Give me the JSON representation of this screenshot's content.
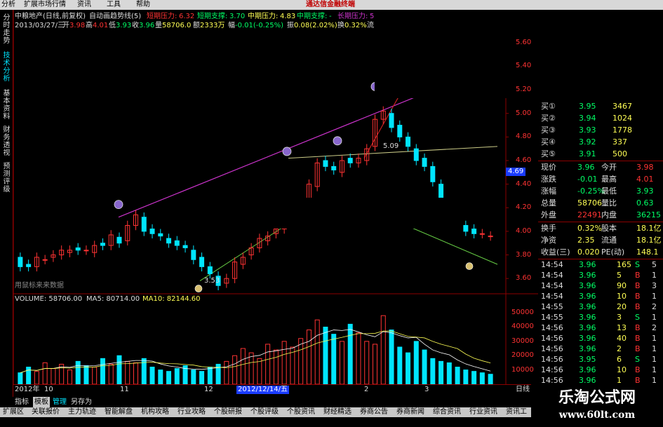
{
  "menu": {
    "items": [
      "分析",
      "扩展市场行情",
      "资讯",
      "工具",
      "帮助"
    ],
    "center_title": "通达信金融终端"
  },
  "sidebar": {
    "tabs": [
      "分时走势",
      "技术分析",
      "基本资料",
      "财务透视",
      "预测评级"
    ],
    "active_index": 1
  },
  "header": {
    "line1": {
      "name": "中粮地产(日线,前复权)",
      "indicator": "自动画趋势线(5)",
      "short_res_label": "短期压力:",
      "short_res_value": "6.32",
      "short_sup_label": "短期支撑:",
      "short_sup_value": "3.70",
      "mid_res_label": "中期压力:",
      "mid_res_value": "4.83",
      "mid_sup_label": "中期支撑:",
      "mid_sup_value": "-",
      "long_res_label": "长期压力:",
      "long_res_value": "5"
    },
    "line2": {
      "date": "2013/03/27/三",
      "open_label": "开",
      "open": "3.98",
      "high_label": "高",
      "high": "4.01",
      "low_label": "低",
      "low": "3.93",
      "close_label": "收",
      "close": "3.96",
      "vol_label": "量",
      "vol": "58706.0",
      "amount_label": "额",
      "amount": "2333万",
      "change_label": "幅",
      "change": "-0.01(-0.25%)",
      "amp_label": "振",
      "amp": "0.08(2.02%)",
      "turnover_label": "换",
      "turnover": "0.32%",
      "flow_label": "流"
    }
  },
  "chart_labels": {
    "peak_price": "5.09",
    "low_price": "3.53",
    "current_price_tag": "4.69",
    "note": "用鼠标来来数据",
    "volume_label": "VOLUME: 58706.00",
    "ma5_label": "MA5: 80714.00",
    "ma10_label": "MA10: 82144.60",
    "x_axis": [
      "2012年",
      "10",
      "11",
      "12",
      "2012/12/14/五",
      "2",
      "3"
    ],
    "price_axis": [
      "5.60",
      "5.40",
      "5.20",
      "5.00",
      "4.80",
      "4.60",
      "4.40",
      "4.20",
      "4.00",
      "3.80",
      "3.60"
    ],
    "volume_axis": [
      "50000",
      "40000",
      "30000",
      "20000",
      "10000"
    ],
    "right_small": "日线",
    "price_axis_values": [
      5.6,
      5.4,
      5.2,
      5.0,
      4.8,
      4.6,
      4.4,
      4.2,
      4.0,
      3.8,
      3.6
    ],
    "volume_axis_values": [
      50000,
      40000,
      30000,
      20000,
      10000
    ]
  },
  "chart_data": {
    "type": "candlestick",
    "title": "",
    "series": [
      {
        "name": "K线",
        "description_open": [
          3.78,
          3.72,
          3.7,
          3.76,
          3.78,
          3.8,
          3.82,
          3.86,
          3.84,
          3.82,
          3.9,
          3.88,
          3.95,
          3.92,
          4.05,
          4.12,
          4.02,
          3.98,
          3.94,
          3.92,
          3.88,
          3.84,
          3.78,
          3.7,
          3.62,
          3.56,
          3.6,
          3.72,
          3.8,
          3.86,
          3.92,
          3.98,
          4.02,
          4.08,
          4.1,
          4.15,
          4.38,
          4.6,
          4.55,
          4.5,
          4.62,
          4.58,
          4.6,
          4.72,
          4.95,
          5.0,
          4.9,
          4.8,
          4.7,
          4.62,
          4.55,
          4.4,
          4.2,
          4.1,
          4.05,
          4.02,
          3.98,
          3.96
        ]
      },
      {
        "name": "VOLUME",
        "values": [
          8000,
          12000,
          9000,
          15000,
          11000,
          14000,
          10000,
          16000,
          13000,
          12000,
          18000,
          14000,
          20000,
          16000,
          15000,
          18000,
          12000,
          10000,
          9000,
          11000,
          13000,
          10000,
          9000,
          12000,
          14000,
          16000,
          20000,
          25000,
          22000,
          18000,
          28000,
          24000,
          30000,
          26000,
          32000,
          38000,
          45000,
          40000,
          35000,
          30000,
          42000,
          36000,
          30000,
          28000,
          48000,
          38000,
          26000,
          22000,
          30000,
          24000,
          18000,
          16000,
          15000,
          12000,
          10000,
          9000,
          8000,
          7000
        ]
      }
    ],
    "ylim": [
      3.5,
      5.7
    ],
    "volume_ylim": [
      0,
      52000
    ]
  },
  "quote": {
    "bids": [
      {
        "label": "买①",
        "price": "3.95",
        "vol": "3467"
      },
      {
        "label": "买②",
        "price": "3.94",
        "vol": "1024"
      },
      {
        "label": "买③",
        "price": "3.93",
        "vol": "1778"
      },
      {
        "label": "买④",
        "price": "3.92",
        "vol": "337"
      },
      {
        "label": "买⑤",
        "price": "3.91",
        "vol": "500"
      }
    ],
    "stats": [
      {
        "l1": "现价",
        "v1": "3.96",
        "l2": "今开",
        "v2": "3.98",
        "c1": "#00ff66",
        "c2": "#ff3333"
      },
      {
        "l1": "涨跌",
        "v1": "-0.01",
        "l2": "最高",
        "v2": "4.01",
        "c1": "#00ff66",
        "c2": "#ff3333"
      },
      {
        "l1": "涨幅",
        "v1": "-0.25%",
        "l2": "最低",
        "v2": "3.93",
        "c1": "#00ff66",
        "c2": "#00ff66"
      },
      {
        "l1": "总量",
        "v1": "58706",
        "l2": "量比",
        "v2": "0.63",
        "c1": "#ffff55",
        "c2": "#00ff66"
      },
      {
        "l1": "外盘",
        "v1": "22491",
        "l2": "内盘",
        "v2": "36215",
        "c1": "#ff3333",
        "c2": "#00ff66"
      },
      {
        "l1": "换手",
        "v1": "0.32%",
        "l2": "股本",
        "v2": "18.1亿",
        "c1": "#ffff55",
        "c2": "#ffff55"
      },
      {
        "l1": "净资",
        "v1": "2.35",
        "l2": "流通",
        "v2": "18.1亿",
        "c1": "#ffff55",
        "c2": "#ffff55"
      },
      {
        "l1": "收益(三)",
        "v1": "0.020",
        "l2": "PE(动)",
        "v2": "148.1",
        "c1": "#ffff55",
        "c2": "#ffff55"
      }
    ],
    "ticks": [
      {
        "time": "14:54",
        "price": "3.96",
        "vol": "165",
        "side": "S",
        "extra": "5"
      },
      {
        "time": "14:54",
        "price": "3.96",
        "vol": "5",
        "side": "B",
        "extra": "1"
      },
      {
        "time": "14:54",
        "price": "3.96",
        "vol": "90",
        "side": "B",
        "extra": "3"
      },
      {
        "time": "14:54",
        "price": "3.96",
        "vol": "10",
        "side": "B",
        "extra": "1"
      },
      {
        "time": "14:55",
        "price": "3.96",
        "vol": "20",
        "side": "B",
        "extra": "2"
      },
      {
        "time": "14:55",
        "price": "3.96",
        "vol": "3",
        "side": "S",
        "extra": "1"
      },
      {
        "time": "14:56",
        "price": "3.96",
        "vol": "13",
        "side": "B",
        "extra": "2"
      },
      {
        "time": "14:56",
        "price": "3.96",
        "vol": "40",
        "side": "B",
        "extra": "1"
      },
      {
        "time": "14:56",
        "price": "3.96",
        "vol": "2",
        "side": "B",
        "extra": "1"
      },
      {
        "time": "14:56",
        "price": "3.95",
        "vol": "6",
        "side": "S",
        "extra": "1"
      },
      {
        "time": "14:56",
        "price": "3.96",
        "vol": "10",
        "side": "B",
        "extra": "1"
      },
      {
        "time": "14:56",
        "price": "3.96",
        "vol": "1",
        "side": "B",
        "extra": "1"
      }
    ]
  },
  "tabs_row": {
    "items": [
      "指标",
      "模板",
      "管理",
      "另存为"
    ]
  },
  "bottom_bar": {
    "items": [
      "扩展区",
      "关联报价",
      "主力轨迹",
      "智能解盘",
      "机构攻略",
      "行业攻略",
      "个股研报",
      "个股评级",
      "个股资讯",
      "财经精选",
      "券商公告",
      "券商新闻",
      "综合资讯",
      "行业资讯",
      "资讯工"
    ]
  },
  "watermark": {
    "title": "乐淘公式网",
    "url": "www.60lt.com"
  },
  "colors": {
    "up": "#ff3333",
    "down": "#00e5ff",
    "purple_line": "#cc33cc",
    "red_line": "#cc2222",
    "yellow_line": "#cccc88",
    "green_line": "#66cc44",
    "ma5": "#ffffff",
    "ma10": "#ffff55"
  }
}
